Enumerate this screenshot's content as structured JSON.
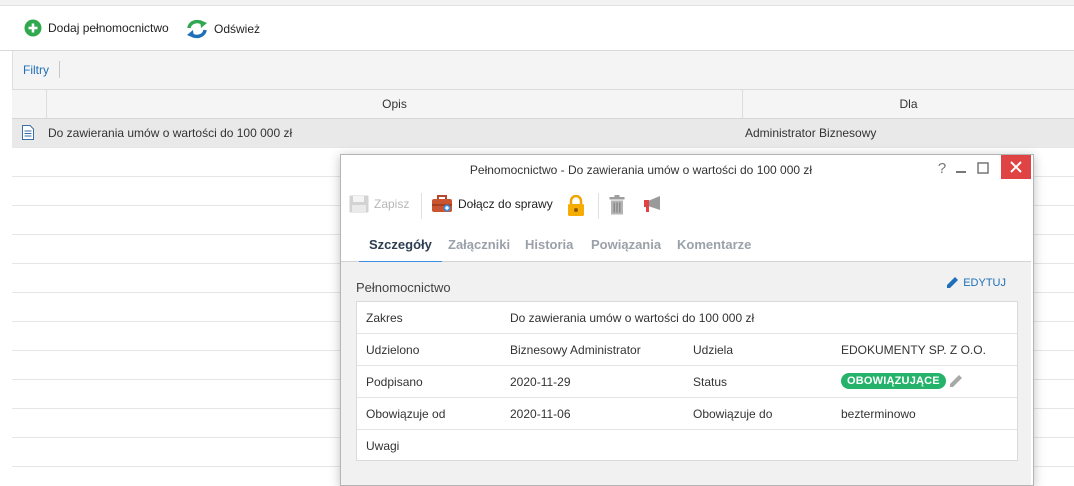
{
  "toolbar": {
    "add_label": "Dodaj pełnomocnictwo",
    "refresh_label": "Odśwież"
  },
  "filters": {
    "label": "Filtry"
  },
  "grid": {
    "columns": [
      "Opis",
      "Dla"
    ],
    "rows": [
      {
        "opis": "Do zawierania umów o wartości do 100 000 zł",
        "dla": "Administrator Biznesowy"
      }
    ]
  },
  "modal": {
    "title": "Pełnomocnictwo - Do zawierania umów o wartości do 100 000 zł",
    "help": "?",
    "toolbar": {
      "save_label": "Zapisz",
      "attach_label": "Dołącz do sprawy"
    },
    "tabs": [
      "Szczegóły",
      "Załączniki",
      "Historia",
      "Powiązania",
      "Komentarze"
    ],
    "section_title": "Pełnomocnictwo",
    "edit_label": "EDYTUJ",
    "details": {
      "zakres_label": "Zakres",
      "zakres_value": "Do zawierania umów o wartości do 100 000 zł",
      "udzielono_label": "Udzielono",
      "udzielono_value": "Biznesowy Administrator",
      "udziela_label": "Udziela",
      "udziela_value": "EDOKUMENTY SP. Z O.O.",
      "podpisano_label": "Podpisano",
      "podpisano_value": "2020-11-29",
      "status_label": "Status",
      "status_value": "OBOWIĄZUJĄCE",
      "obowiazuje_od_label": "Obowiązuje od",
      "obowiazuje_od_value": "2020-11-06",
      "obowiazuje_do_label": "Obowiązuje do",
      "obowiazuje_do_value": "bezterminowo",
      "uwagi_label": "Uwagi",
      "uwagi_value": ""
    }
  },
  "colors": {
    "accent": "#1e6fb8",
    "add_green": "#2fa84f",
    "status_green": "#25b36b",
    "close_red": "#e04343",
    "tab_active_underline": "#3d8ede"
  },
  "icons": [
    "plus-circle-icon",
    "refresh-icon",
    "document-icon",
    "save-icon",
    "briefcase-icon",
    "lock-icon",
    "trash-icon",
    "megaphone-icon",
    "pencil-icon",
    "minimize-icon",
    "maximize-icon",
    "close-icon"
  ]
}
